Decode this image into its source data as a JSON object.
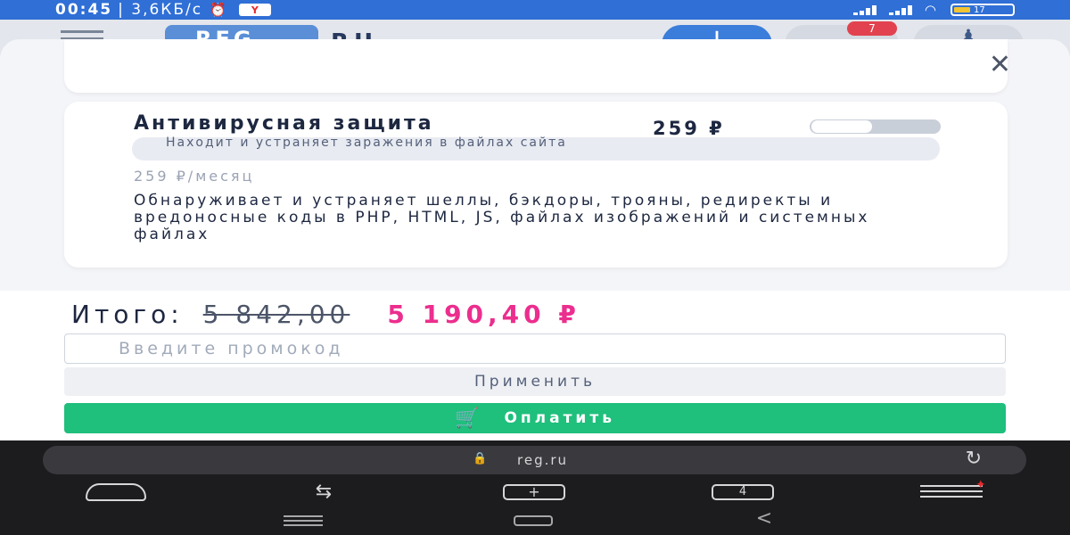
{
  "status_bar": {
    "time": "00:45",
    "speed": "| 3,6КБ/с",
    "alarm_icon": "⏰",
    "ya_badge": "Y",
    "wifi_icon": "◠",
    "battery": "17"
  },
  "site_header": {
    "logo_text": "REG",
    "logo_suffix": "RU",
    "plus_label": "+",
    "notifications_count": "7",
    "user_icon": "♟"
  },
  "modal": {
    "close_icon": "✕",
    "service": {
      "title": "Антивирусная защита",
      "price": "259 ₽",
      "subtitle": "Находит и устраняет заражения в файлах сайта",
      "monthly": "259 ₽/месяц",
      "description": "Обнаруживает и устраняет шеллы, бэкдоры, трояны, редиректы и вредоносные коды в PHP, HTML, JS, файлах изображений и системных файлах",
      "enabled": false
    },
    "total": {
      "label": "Итого:",
      "old_price": "5 842,00",
      "new_price": "5 190,40 ₽"
    },
    "promo_placeholder": "Введите промокод",
    "apply_label": "Применить",
    "pay_label": "Оплатить",
    "pay_icon": "🛒"
  },
  "browser": {
    "lock_icon": "🔒",
    "url": "reg.ru",
    "reload_icon": "↻",
    "share_icon": "⇆",
    "newtab_icon": "+",
    "tabs_count": "4"
  },
  "system_nav": {
    "back_icon": "<"
  },
  "colors": {
    "accent_pink": "#ec2e8e",
    "pay_green": "#1fbf7c",
    "status_blue": "#2f6fd6"
  }
}
